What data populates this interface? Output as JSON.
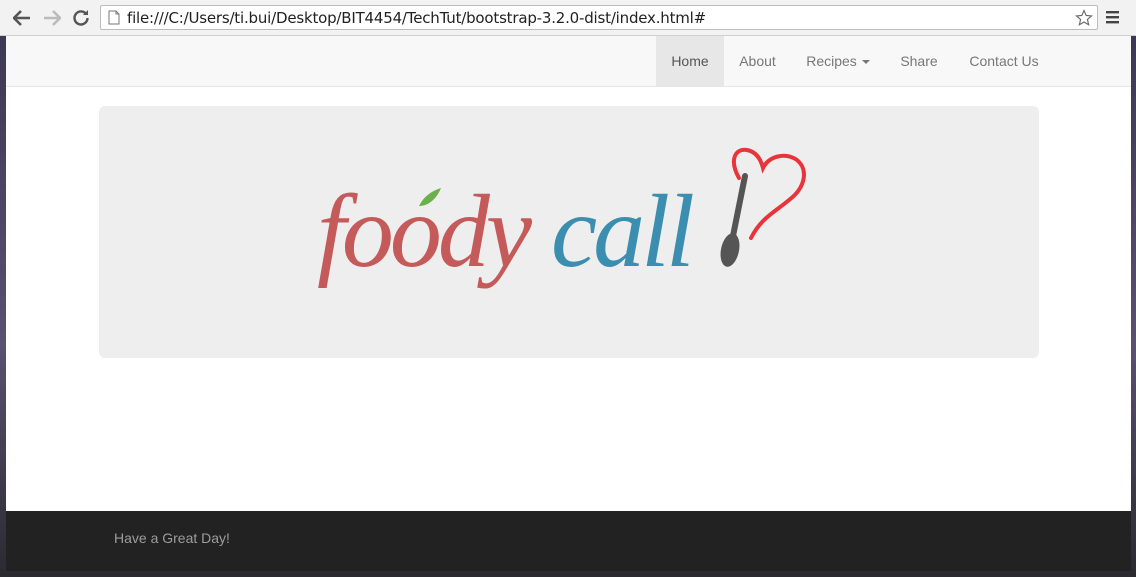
{
  "browser": {
    "url": "file:///C:/Users/ti.bui/Desktop/BIT4454/TechTut/bootstrap-3.2.0-dist/index.html#"
  },
  "navbar": {
    "items": [
      {
        "label": "Home",
        "active": true
      },
      {
        "label": "About"
      },
      {
        "label": "Recipes"
      },
      {
        "label": "Share"
      },
      {
        "label": "Contact Us"
      }
    ]
  },
  "logo": {
    "text_part1": "foody",
    "text_part2": "call",
    "colors": {
      "part1": "#c55a5a",
      "part2": "#3b8eb0",
      "heart": "#e8343a",
      "spoon": "#555555",
      "leaf": "#6ab04c"
    }
  },
  "footer": {
    "text": "Have a Great Day!"
  }
}
